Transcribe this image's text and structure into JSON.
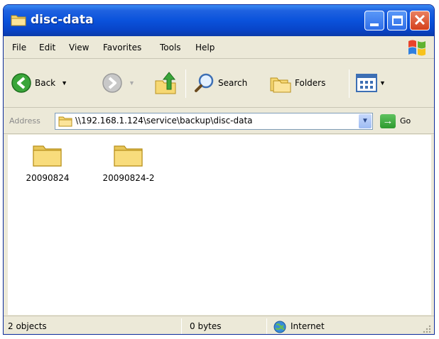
{
  "window": {
    "title": "disc-data"
  },
  "menu": {
    "items": [
      "File",
      "Edit",
      "View",
      "Favorites",
      "Tools",
      "Help"
    ]
  },
  "toolbar": {
    "back_label": "Back",
    "search_label": "Search",
    "folders_label": "Folders"
  },
  "address": {
    "label": "Address",
    "path": "\\\\192.168.1.124\\service\\backup\\disc-data",
    "go_label": "Go"
  },
  "folders": [
    {
      "name": "20090824"
    },
    {
      "name": "20090824-2"
    }
  ],
  "status": {
    "objects": "2 objects",
    "size": "0 bytes",
    "zone": "Internet"
  },
  "colors": {
    "titlebar": "#0a52db",
    "chrome": "#ece9d8",
    "folder": "#f4d36c",
    "close_button": "#d4401c"
  }
}
